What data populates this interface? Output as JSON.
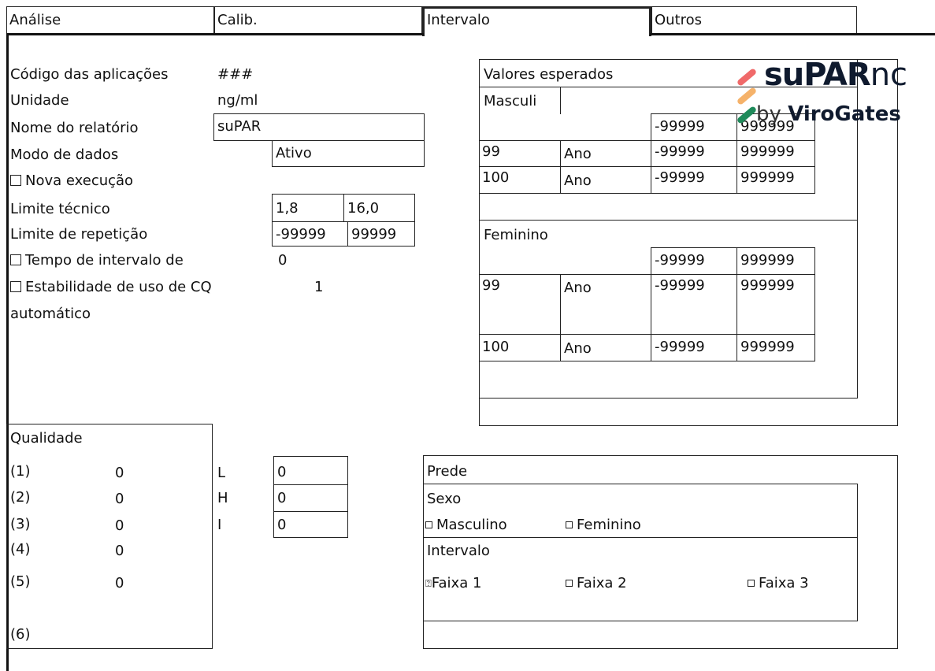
{
  "tabs": [
    "Análise",
    "Calib.",
    "Intervalo",
    "Outros"
  ],
  "form": {
    "app_code_label": "Código das aplicações",
    "app_code_value": "###",
    "unit_label": "Unidade",
    "unit_value": "ng/ml",
    "report_name_label": "Nome do relatório",
    "report_name_value": "suPAR",
    "data_mode_label": "Modo de dados",
    "data_mode_value": "Ativo",
    "rerun_label": "Nova execução",
    "tech_limit_label": "Limite técnico",
    "tech_limit_low": "1,8",
    "tech_limit_high": "16,0",
    "repeat_limit_label": "Limite de repetição",
    "repeat_limit_low": "-99999",
    "repeat_limit_high": "99999",
    "interval_time_label": "Tempo de intervalo de",
    "interval_time_value": "0",
    "qc_stability_label": "Estabilidade de uso de CQ",
    "qc_stability_label2": "automático",
    "qc_stability_value": "1"
  },
  "expected": {
    "title": "Valores esperados",
    "male_label": "Masculi",
    "male_default": {
      "low": "-99999",
      "high": "999999"
    },
    "male_rows": [
      {
        "age": "99",
        "unit": "Ano",
        "low": "-99999",
        "high": "999999"
      },
      {
        "age": "100",
        "unit": "Ano",
        "low": "-99999",
        "high": "999999"
      }
    ],
    "female_label": "Feminino",
    "female_default": {
      "low": "-99999",
      "high": "999999"
    },
    "female_rows": [
      {
        "age": "99",
        "unit": "Ano",
        "low": "-99999",
        "high": "999999"
      },
      {
        "age": "100",
        "unit": "Ano",
        "low": "-99999",
        "high": "999999"
      }
    ]
  },
  "logo": {
    "main": "suPAR",
    "suffix": "nc",
    "by": "by",
    "brand": "ViroGates",
    "colors": [
      "#f06a6a",
      "#f5b26a",
      "#1f8a5a"
    ]
  },
  "quality": {
    "title": "Qualidade",
    "rows": [
      {
        "label": "(1)",
        "value": "0"
      },
      {
        "label": "(2)",
        "value": "0"
      },
      {
        "label": "(3)",
        "value": "0"
      },
      {
        "label": "(4)",
        "value": "0"
      },
      {
        "label": "(5)",
        "value": "0"
      },
      {
        "label": "(6)",
        "value": ""
      }
    ],
    "lhi": [
      {
        "label": "L",
        "value": "0"
      },
      {
        "label": "H",
        "value": "0"
      },
      {
        "label": "I",
        "value": "0"
      }
    ]
  },
  "predef": {
    "title": "Prede",
    "sex_label": "Sexo",
    "sex_options": [
      "Masculino",
      "Feminino"
    ],
    "interval_label": "Intervalo",
    "interval_options": [
      "Faixa 1",
      "Faixa 2",
      "Faixa 3"
    ],
    "checked_symbol": "⍰"
  }
}
